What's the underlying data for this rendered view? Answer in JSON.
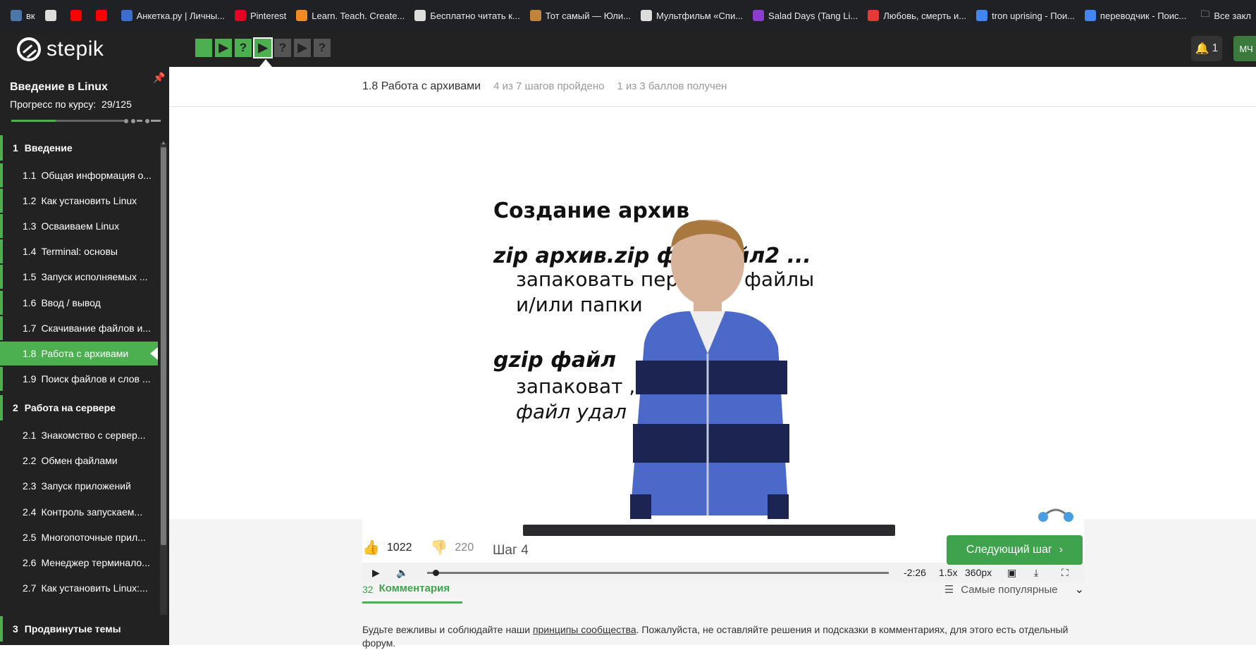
{
  "bookmarks": [
    {
      "label": "вк",
      "color": "#4a76a8"
    },
    {
      "label": "",
      "color": "#ddd",
      "icon": "globe-icon"
    },
    {
      "label": "",
      "color": "#ff0000",
      "icon": "youtube-icon"
    },
    {
      "label": "",
      "color": "#ff0000",
      "icon": "youtube-icon"
    },
    {
      "label": "Анкетка.ру | Личны...",
      "color": "#3b6fcf"
    },
    {
      "label": "Pinterest",
      "color": "#e60023"
    },
    {
      "label": "Learn. Teach. Create...",
      "color": "#f08a24"
    },
    {
      "label": "Бесплатно читать к...",
      "color": "#ddd"
    },
    {
      "label": "Тот самый — Юли...",
      "color": "#c0843c"
    },
    {
      "label": "Мультфильм «Спи...",
      "color": "#ddd"
    },
    {
      "label": "Salad Days (Tang Li...",
      "color": "#8d3ccf"
    },
    {
      "label": "Любовь, смерть и...",
      "color": "#e53935"
    },
    {
      "label": "tron uprising - Пои...",
      "color": "#4285f4"
    },
    {
      "label": "переводчик - Поис...",
      "color": "#4285f4"
    }
  ],
  "bookmarks_folder": "Все закл",
  "header": {
    "logo_text": "stepik",
    "steps": [
      {
        "state": "done",
        "glyph": ""
      },
      {
        "state": "done",
        "glyph": "▶"
      },
      {
        "state": "done",
        "glyph": "?"
      },
      {
        "state": "current",
        "glyph": "▶"
      },
      {
        "state": "todo",
        "glyph": "?"
      },
      {
        "state": "todo",
        "glyph": "▶"
      },
      {
        "state": "todo",
        "glyph": "?"
      }
    ],
    "notifications_count": "1",
    "avatar_initials": "МЧ"
  },
  "sidebar": {
    "course_title": "Введение в Linux",
    "progress_label": "Прогресс по курсу:",
    "progress_value": "29/125",
    "progress_fraction": 0.232,
    "sections": [
      {
        "num": "1",
        "title": "Введение"
      },
      {
        "num": "2",
        "title": "Работа на сервере"
      },
      {
        "num": "3",
        "title": "Продвинутые темы"
      }
    ],
    "lessons": [
      {
        "num": "1.1",
        "title": "Общая информация о..."
      },
      {
        "num": "1.2",
        "title": "Как установить Linux"
      },
      {
        "num": "1.3",
        "title": "Осваиваем Linux"
      },
      {
        "num": "1.4",
        "title": "Terminal: основы"
      },
      {
        "num": "1.5",
        "title": "Запуск исполняемых ..."
      },
      {
        "num": "1.6",
        "title": "Ввод / вывод"
      },
      {
        "num": "1.7",
        "title": "Скачивание файлов и..."
      },
      {
        "num": "1.8",
        "title": "Работа с архивами"
      },
      {
        "num": "1.9",
        "title": "Поиск файлов и слов ..."
      },
      {
        "num": "2.1",
        "title": "Знакомство с сервер..."
      },
      {
        "num": "2.2",
        "title": "Обмен файлами"
      },
      {
        "num": "2.3",
        "title": "Запуск приложений"
      },
      {
        "num": "2.4",
        "title": "Контроль запускаем..."
      },
      {
        "num": "2.5",
        "title": "Многопоточные прил..."
      },
      {
        "num": "2.6",
        "title": "Менеджер терминало..."
      },
      {
        "num": "2.7",
        "title": "Как установить Linux:..."
      }
    ]
  },
  "lesson": {
    "title": "1.8 Работа с архивами",
    "steps_done": "4 из 7 шагов пройдено",
    "points": "1 из 3 баллов  получен"
  },
  "video": {
    "slide_title": "Создание архив",
    "line1_cmd": "zip  архив.zip  фа    файл2 ...",
    "line2": "запаковать пер        нные файлы",
    "line3": "и/или папки",
    "line4_cmd": "gzip файл",
    "line5": "запаковат              , исходный",
    "line6": "файл удал",
    "time_remaining": "-2:26",
    "speed": "1.5x",
    "quality": "360px",
    "progress_fraction": 0.012
  },
  "feedback": {
    "likes": "1022",
    "dislikes": "220",
    "step_label": "Шаг 4",
    "next_button": "Следующий шаг"
  },
  "comments": {
    "count": "32",
    "tab_label": "Комментария",
    "sort_label": "Самые популярные",
    "rules_prefix": "Будьте вежливы и соблюдайте наши ",
    "rules_link": "принципы сообщества",
    "rules_suffix": ". Пожалуйста, не оставляйте решения и подсказки в комментариях, для этого есть отдельный форум."
  }
}
